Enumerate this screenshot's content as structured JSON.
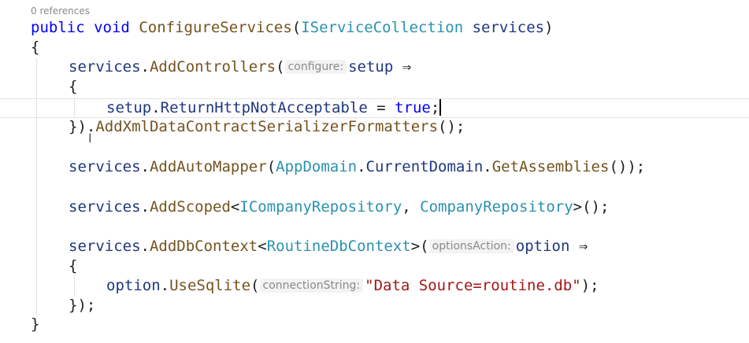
{
  "editor": {
    "codelens": "0 references",
    "tokens": {
      "public": "public",
      "void": "void",
      "configure_services": "ConfigureServices",
      "open_paren": "(",
      "iservice_collection": "IServiceCollection",
      "services_param": "services",
      "close_paren": ")",
      "brace_open": "{",
      "brace_close": "}",
      "services": "services",
      "dot": ".",
      "add_controllers": "AddControllers",
      "hint_configure": "configure:",
      "setup": "setup",
      "arrow": "⇒",
      "return_http": "ReturnHttpNotAcceptable",
      "equals": " = ",
      "true_kw": "true",
      "semicolon": ";",
      "close_brace_paren": "})",
      "add_xml": "AddXmlDataContractSerializerFormatters",
      "empty_call": "();",
      "add_automapper": "AddAutoMapper",
      "appdomain": "AppDomain",
      "current_domain": "CurrentDomain",
      "get_assemblies": "GetAssemblies",
      "paren_close_semicolon": "());",
      "add_scoped": "AddScoped",
      "lt": "<",
      "icompany_repo": "ICompanyRepository",
      "comma": ", ",
      "company_repo": "CompanyRepository",
      "gt_call": ">();",
      "add_dbcontext": "AddDbContext",
      "routine_dbcontext": "RoutineDbContext",
      "gt_paren": ">(",
      "hint_options_action": "optionsAction:",
      "option": "option",
      "use_sqlite": "UseSqlite",
      "hint_connection_string": "connectionString:",
      "conn_string": "\"Data Source=routine.db\"",
      "close_paren_semicolon": ");",
      "close_brace_paren_semicolon": "});"
    }
  }
}
